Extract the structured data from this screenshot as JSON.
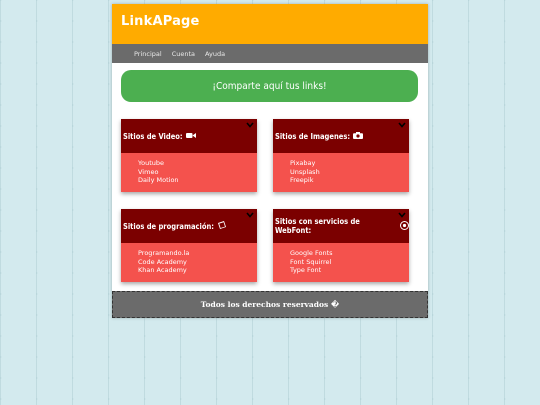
{
  "header": {
    "logo": "LinkAPage",
    "brand_color": "#ffab00"
  },
  "nav": {
    "items": [
      "Principal",
      "Cuenta",
      "Ayuda"
    ]
  },
  "banner": {
    "text": "¡Comparte aquí tus links!",
    "color": "#4caf50"
  },
  "cards": [
    {
      "title": "Sitios de Video:",
      "icon": "video-camera-icon",
      "links": [
        "Youtube",
        "Vimeo",
        "Daily Motion"
      ]
    },
    {
      "title": "Sitios de Imagenes:",
      "icon": "camera-icon",
      "links": [
        "Pixabay",
        "Unsplash",
        "Freepik"
      ]
    },
    {
      "title": "Sitios de programación:",
      "icon": "book-icon",
      "links": [
        "Programando.la",
        "Code Academy",
        "Khan Academy"
      ]
    },
    {
      "title": "Sitios con servicios de WebFont:",
      "icon": "font-icon",
      "links": [
        "Google Fonts",
        "Font Squirrel",
        "Type Font"
      ]
    }
  ],
  "colors": {
    "card_header": "#7b0000",
    "card_body": "#f4524d",
    "nav": "#6b6b6b"
  },
  "footer": {
    "text": "Todos los derechos reservados �"
  }
}
